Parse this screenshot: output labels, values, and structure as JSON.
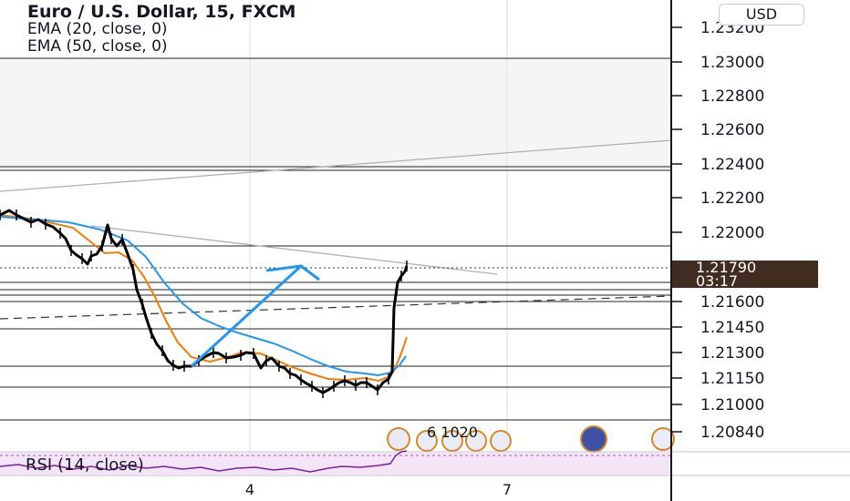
{
  "legend": {
    "title": "Euro / U.S. Dollar, 15, FXCM",
    "ema20": "EMA (20, close, 0)",
    "ema50": "EMA (50, close, 0)"
  },
  "currency_button": "USD",
  "price_axis": {
    "ticks": [
      "1.23200",
      "1.23000",
      "1.22800",
      "1.22600",
      "1.22400",
      "1.22200",
      "1.22000",
      "1.21600",
      "1.21450",
      "1.21300",
      "1.21150",
      "1.21000",
      "1.20840"
    ]
  },
  "last_price": {
    "price": "1.21790",
    "countdown": "03:17"
  },
  "time_axis": {
    "labels": [
      "4",
      "7"
    ]
  },
  "event_label": "6 1020",
  "rsi_label": "RSI (14, close)",
  "colors": {
    "candles": "#000000",
    "ema20": "#f57c00",
    "ema50": "#2196f3",
    "arrow": "#2196f3",
    "rsi": "#7b1fa2",
    "price_tag": "#402c20"
  }
}
